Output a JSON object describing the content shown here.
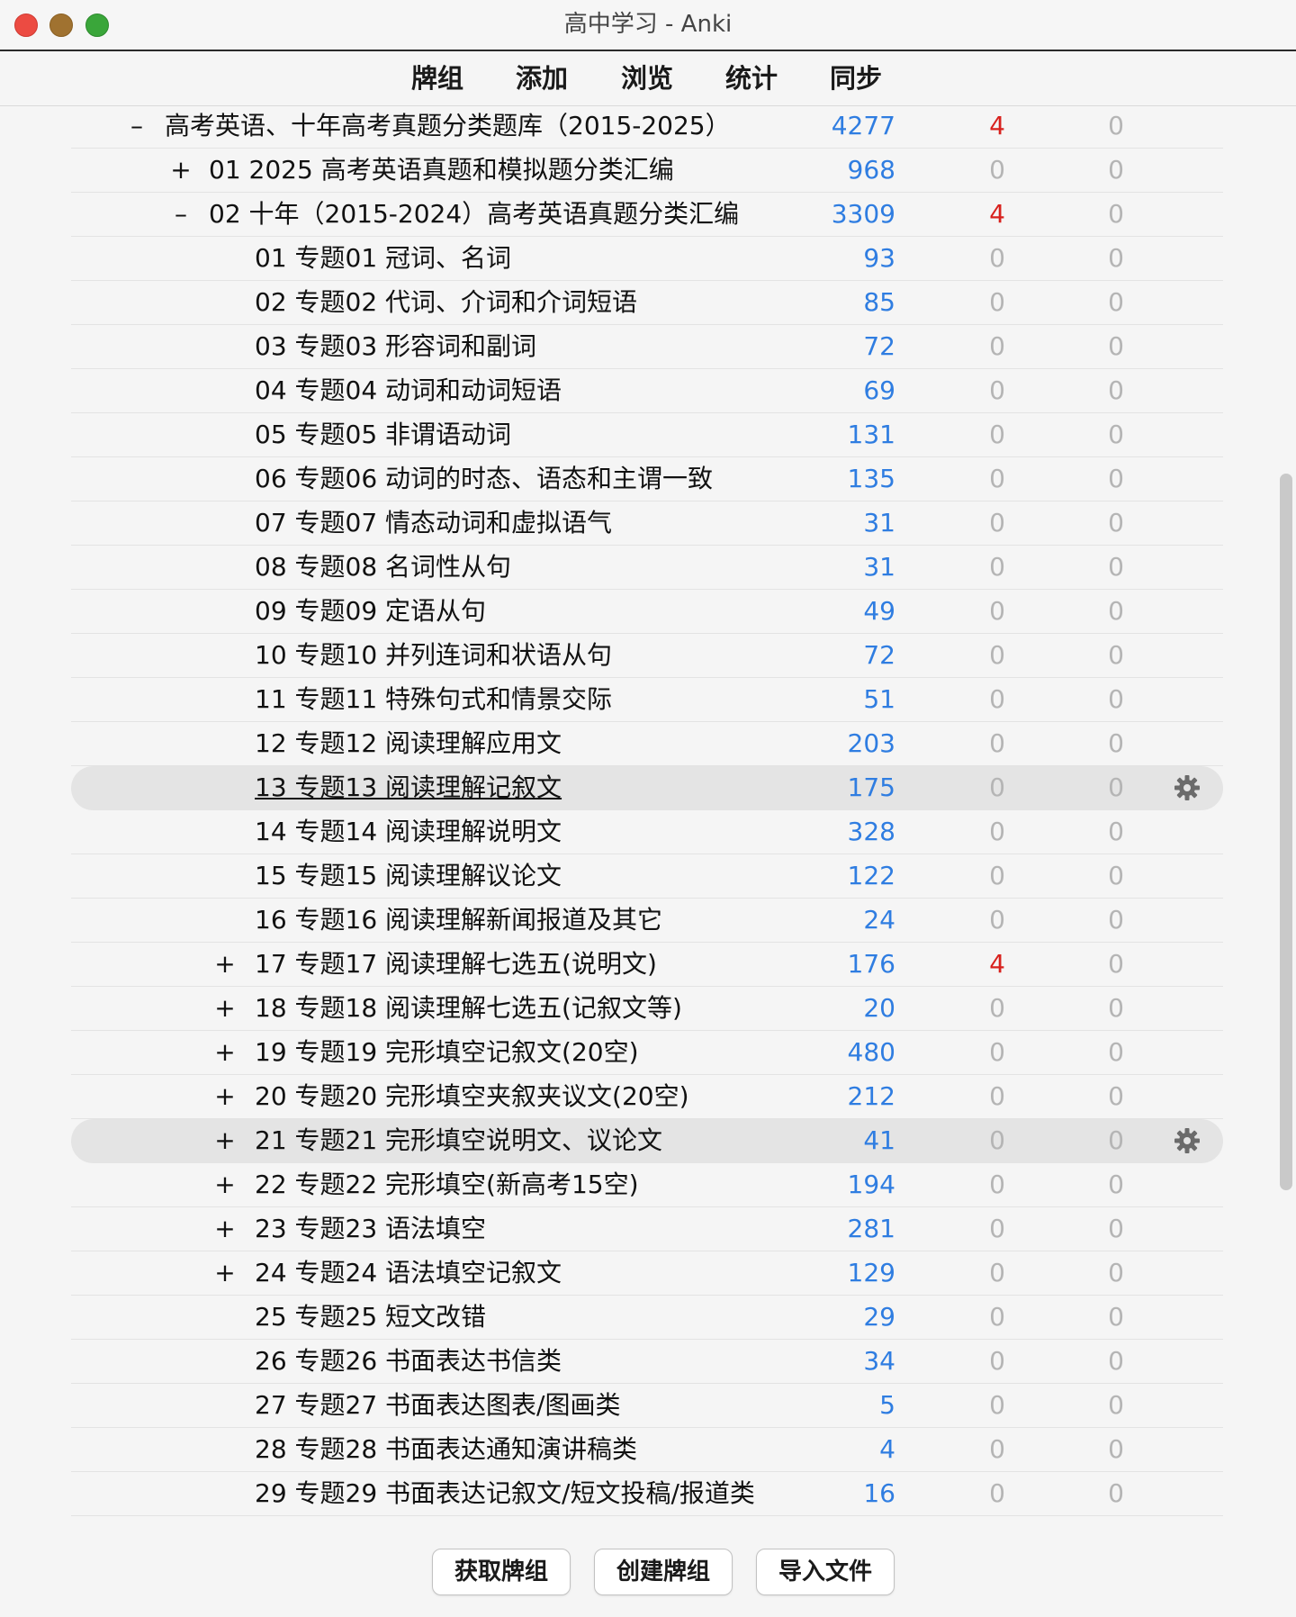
{
  "window": {
    "title": "高中学习 - Anki"
  },
  "toolbar": {
    "items": [
      "牌组",
      "添加",
      "浏览",
      "统计",
      "同步"
    ]
  },
  "decks": [
    {
      "toggle": "–",
      "name": "高考英语、十年高考真题分类题库（2015-2025）",
      "new": "4277",
      "learn": "4",
      "due": "0",
      "learn_red": true,
      "selected": false
    },
    {
      "toggle": "+",
      "name": "01 2025 高考英语真题和模拟题分类汇编",
      "new": "968",
      "learn": "0",
      "due": "0",
      "learn_red": false,
      "selected": false
    },
    {
      "toggle": "–",
      "name": "02 十年（2015-2024）高考英语真题分类汇编",
      "new": "3309",
      "learn": "4",
      "due": "0",
      "learn_red": true,
      "selected": false
    },
    {
      "toggle": "",
      "name": "01 专题01 冠词、名词",
      "new": "93",
      "learn": "0",
      "due": "0",
      "learn_red": false,
      "selected": false
    },
    {
      "toggle": "",
      "name": "02 专题02 代词、介词和介词短语",
      "new": "85",
      "learn": "0",
      "due": "0",
      "learn_red": false,
      "selected": false
    },
    {
      "toggle": "",
      "name": "03 专题03 形容词和副词",
      "new": "72",
      "learn": "0",
      "due": "0",
      "learn_red": false,
      "selected": false
    },
    {
      "toggle": "",
      "name": "04 专题04 动词和动词短语",
      "new": "69",
      "learn": "0",
      "due": "0",
      "learn_red": false,
      "selected": false
    },
    {
      "toggle": "",
      "name": "05 专题05 非谓语动词",
      "new": "131",
      "learn": "0",
      "due": "0",
      "learn_red": false,
      "selected": false
    },
    {
      "toggle": "",
      "name": "06 专题06 动词的时态、语态和主谓一致",
      "new": "135",
      "learn": "0",
      "due": "0",
      "learn_red": false,
      "selected": false
    },
    {
      "toggle": "",
      "name": "07 专题07 情态动词和虚拟语气",
      "new": "31",
      "learn": "0",
      "due": "0",
      "learn_red": false,
      "selected": false
    },
    {
      "toggle": "",
      "name": "08 专题08 名词性从句",
      "new": "31",
      "learn": "0",
      "due": "0",
      "learn_red": false,
      "selected": false
    },
    {
      "toggle": "",
      "name": "09 专题09 定语从句",
      "new": "49",
      "learn": "0",
      "due": "0",
      "learn_red": false,
      "selected": false
    },
    {
      "toggle": "",
      "name": "10 专题10 并列连词和状语从句",
      "new": "72",
      "learn": "0",
      "due": "0",
      "learn_red": false,
      "selected": false
    },
    {
      "toggle": "",
      "name": "11 专题11 特殊句式和情景交际",
      "new": "51",
      "learn": "0",
      "due": "0",
      "learn_red": false,
      "selected": false
    },
    {
      "toggle": "",
      "name": "12 专题12 阅读理解应用文",
      "new": "203",
      "learn": "0",
      "due": "0",
      "learn_red": false,
      "selected": false
    },
    {
      "toggle": "",
      "name": "13 专题13 阅读理解记叙文",
      "new": "175",
      "learn": "0",
      "due": "0",
      "learn_red": false,
      "selected": true,
      "current": true
    },
    {
      "toggle": "",
      "name": "14 专题14 阅读理解说明文",
      "new": "328",
      "learn": "0",
      "due": "0",
      "learn_red": false,
      "selected": false
    },
    {
      "toggle": "",
      "name": "15 专题15 阅读理解议论文",
      "new": "122",
      "learn": "0",
      "due": "0",
      "learn_red": false,
      "selected": false
    },
    {
      "toggle": "",
      "name": "16 专题16 阅读理解新闻报道及其它",
      "new": "24",
      "learn": "0",
      "due": "0",
      "learn_red": false,
      "selected": false
    },
    {
      "toggle": "+",
      "name": "17 专题17 阅读理解七选五(说明文)",
      "new": "176",
      "learn": "4",
      "due": "0",
      "learn_red": true,
      "selected": false
    },
    {
      "toggle": "+",
      "name": "18 专题18 阅读理解七选五(记叙文等)",
      "new": "20",
      "learn": "0",
      "due": "0",
      "learn_red": false,
      "selected": false
    },
    {
      "toggle": "+",
      "name": "19 专题19 完形填空记叙文(20空)",
      "new": "480",
      "learn": "0",
      "due": "0",
      "learn_red": false,
      "selected": false
    },
    {
      "toggle": "+",
      "name": "20 专题20 完形填空夹叙夹议文(20空)",
      "new": "212",
      "learn": "0",
      "due": "0",
      "learn_red": false,
      "selected": false
    },
    {
      "toggle": "+",
      "name": "21 专题21 完形填空说明文、议论文",
      "new": "41",
      "learn": "0",
      "due": "0",
      "learn_red": false,
      "selected": true
    },
    {
      "toggle": "+",
      "name": "22 专题22 完形填空(新高考15空)",
      "new": "194",
      "learn": "0",
      "due": "0",
      "learn_red": false,
      "selected": false
    },
    {
      "toggle": "+",
      "name": "23 专题23 语法填空",
      "new": "281",
      "learn": "0",
      "due": "0",
      "learn_red": false,
      "selected": false
    },
    {
      "toggle": "+",
      "name": "24 专题24 语法填空记叙文",
      "new": "129",
      "learn": "0",
      "due": "0",
      "learn_red": false,
      "selected": false
    },
    {
      "toggle": "",
      "name": "25 专题25 短文改错",
      "new": "29",
      "learn": "0",
      "due": "0",
      "learn_red": false,
      "selected": false
    },
    {
      "toggle": "",
      "name": "26 专题26 书面表达书信类",
      "new": "34",
      "learn": "0",
      "due": "0",
      "learn_red": false,
      "selected": false
    },
    {
      "toggle": "",
      "name": "27 专题27 书面表达图表/图画类",
      "new": "5",
      "learn": "0",
      "due": "0",
      "learn_red": false,
      "selected": false
    },
    {
      "toggle": "",
      "name": "28 专题28 书面表达通知演讲稿类",
      "new": "4",
      "learn": "0",
      "due": "0",
      "learn_red": false,
      "selected": false
    },
    {
      "toggle": "",
      "name": "29 专题29 书面表达记叙文/短文投稿/报道类",
      "new": "16",
      "learn": "0",
      "due": "0",
      "learn_red": false,
      "selected": false
    }
  ],
  "bottom": {
    "get_shared": "获取牌组",
    "create_deck": "创建牌组",
    "import_file": "导入文件"
  },
  "colors": {
    "new_count": "#2f7de1",
    "learn_count": "#d8211d",
    "zero_count": "#b5b5b5"
  },
  "icons": {
    "deck_options": "gear-icon"
  }
}
